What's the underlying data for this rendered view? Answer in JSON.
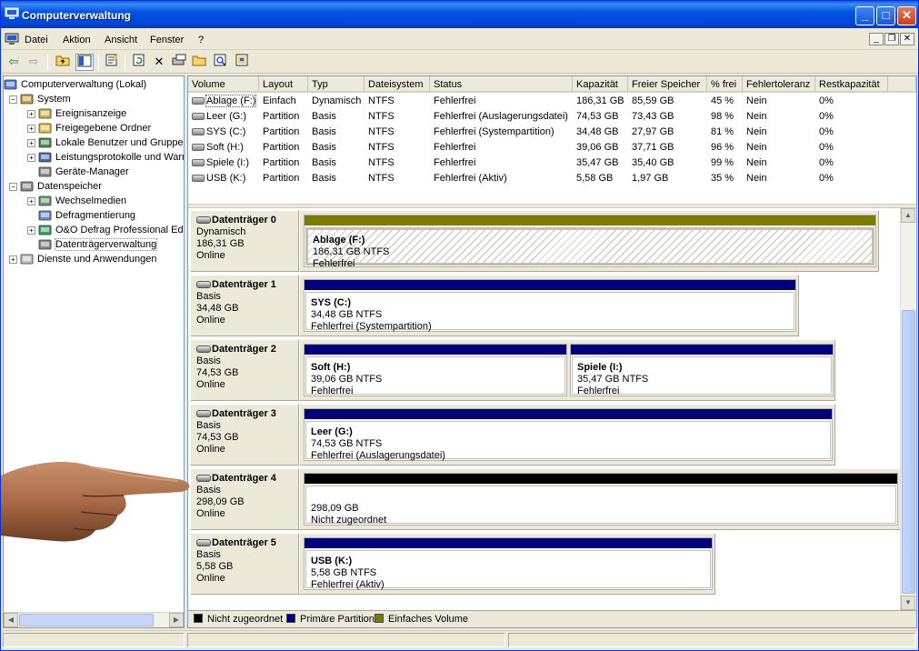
{
  "window": {
    "title": "Computerverwaltung"
  },
  "title_buttons": {
    "minimize": "_",
    "maximize": "□",
    "close": "✕"
  },
  "menu": {
    "items": [
      "Datei",
      "Aktion",
      "Ansicht",
      "Fenster",
      "?"
    ]
  },
  "mdi_buttons": {
    "minimize": "_",
    "restore": "❐",
    "close": "✕"
  },
  "tree": {
    "items": [
      {
        "label": "Computerverwaltung (Lokal)",
        "level": 0,
        "expander": "",
        "icon": "computer-icon"
      },
      {
        "label": "System",
        "level": 1,
        "expander": "−",
        "icon": "tools-icon"
      },
      {
        "label": "Ereignisanzeige",
        "level": 2,
        "expander": "+",
        "icon": "event-viewer-icon"
      },
      {
        "label": "Freigegebene Ordner",
        "level": 2,
        "expander": "+",
        "icon": "shared-folder-icon"
      },
      {
        "label": "Lokale Benutzer und Gruppen",
        "level": 2,
        "expander": "+",
        "icon": "users-icon"
      },
      {
        "label": "Leistungsprotokolle und Warnungen",
        "level": 2,
        "expander": "+",
        "icon": "performance-icon"
      },
      {
        "label": "Geräte-Manager",
        "level": 2,
        "expander": "",
        "icon": "device-manager-icon"
      },
      {
        "label": "Datenspeicher",
        "level": 1,
        "expander": "−",
        "icon": "storage-icon"
      },
      {
        "label": "Wechselmedien",
        "level": 2,
        "expander": "+",
        "icon": "removable-media-icon"
      },
      {
        "label": "Defragmentierung",
        "level": 2,
        "expander": "",
        "icon": "defrag-icon"
      },
      {
        "label": "O&O Defrag Professional Edition",
        "level": 2,
        "expander": "+",
        "icon": "oo-defrag-icon"
      },
      {
        "label": "Datenträgerverwaltung",
        "level": 2,
        "expander": "",
        "icon": "disk-management-icon",
        "selected": true
      },
      {
        "label": "Dienste und Anwendungen",
        "level": 1,
        "expander": "+",
        "icon": "services-icon"
      }
    ]
  },
  "volumes": {
    "columns": [
      "Volume",
      "Layout",
      "Typ",
      "Dateisystem",
      "Status",
      "Kapazität",
      "Freier Speicher",
      "% frei",
      "Fehlertoleranz",
      "Restkapazität"
    ],
    "rows": [
      [
        "Ablage (F:)",
        "Einfach",
        "Dynamisch",
        "NTFS",
        "Fehlerfrei",
        "186,31 GB",
        "85,59 GB",
        "45 %",
        "Nein",
        "0%"
      ],
      [
        "Leer (G:)",
        "Partition",
        "Basis",
        "NTFS",
        "Fehlerfrei (Auslagerungsdatei)",
        "74,53 GB",
        "73,43 GB",
        "98 %",
        "Nein",
        "0%"
      ],
      [
        "SYS (C:)",
        "Partition",
        "Basis",
        "NTFS",
        "Fehlerfrei (Systempartition)",
        "34,48 GB",
        "27,97 GB",
        "81 %",
        "Nein",
        "0%"
      ],
      [
        "Soft (H:)",
        "Partition",
        "Basis",
        "NTFS",
        "Fehlerfrei",
        "39,06 GB",
        "37,71 GB",
        "96 %",
        "Nein",
        "0%"
      ],
      [
        "Spiele (I:)",
        "Partition",
        "Basis",
        "NTFS",
        "Fehlerfrei",
        "35,47 GB",
        "35,40 GB",
        "99 %",
        "Nein",
        "0%"
      ],
      [
        "USB (K:)",
        "Partition",
        "Basis",
        "NTFS",
        "Fehlerfrei (Aktiv)",
        "5,58 GB",
        "1,97 GB",
        "35 %",
        "Nein",
        "0%"
      ]
    ]
  },
  "disks": [
    {
      "name": "Datenträger 0",
      "type": "Dynamisch",
      "size": "186,31 GB",
      "state": "Online",
      "partitions": [
        {
          "title": "Ablage  (F:)",
          "line2": "186,31 GB NTFS",
          "line3": "Fehlerfrei",
          "kind": "simple"
        }
      ]
    },
    {
      "name": "Datenträger 1",
      "type": "Basis",
      "size": "34,48 GB",
      "state": "Online",
      "partitions": [
        {
          "title": "SYS  (C:)",
          "line2": "34,48 GB NTFS",
          "line3": "Fehlerfrei (Systempartition)",
          "kind": "primary"
        }
      ]
    },
    {
      "name": "Datenträger 2",
      "type": "Basis",
      "size": "74,53 GB",
      "state": "Online",
      "partitions": [
        {
          "title": "Soft  (H:)",
          "line2": "39,06 GB NTFS",
          "line3": "Fehlerfrei",
          "kind": "primary"
        },
        {
          "title": "Spiele  (I:)",
          "line2": "35,47 GB NTFS",
          "line3": "Fehlerfrei",
          "kind": "primary"
        }
      ]
    },
    {
      "name": "Datenträger 3",
      "type": "Basis",
      "size": "74,53 GB",
      "state": "Online",
      "partitions": [
        {
          "title": "Leer  (G:)",
          "line2": "74,53 GB NTFS",
          "line3": "Fehlerfrei (Auslagerungsdatei)",
          "kind": "primary"
        }
      ]
    },
    {
      "name": "Datenträger 4",
      "type": "Basis",
      "size": "298,09 GB",
      "state": "Online",
      "partitions": [
        {
          "title": "",
          "line2": "298,09 GB",
          "line3": "Nicht zugeordnet",
          "kind": "unallocated"
        }
      ]
    },
    {
      "name": "Datenträger 5",
      "type": "Basis",
      "size": "5,58 GB",
      "state": "Online",
      "partitions": [
        {
          "title": "USB  (K:)",
          "line2": "5,58 GB NTFS",
          "line3": "Fehlerfrei (Aktiv)",
          "kind": "primary"
        }
      ]
    }
  ],
  "legend": [
    {
      "label": "Nicht zugeordnet",
      "color": "#000000"
    },
    {
      "label": "Primäre Partition",
      "color": "#00007b"
    },
    {
      "label": "Einfaches Volume",
      "color": "#7b7b00"
    }
  ],
  "colors": {
    "primary": "#00007b",
    "simple": "#7b7b00",
    "unallocated": "#000000",
    "titlebar": "#0054e3"
  }
}
